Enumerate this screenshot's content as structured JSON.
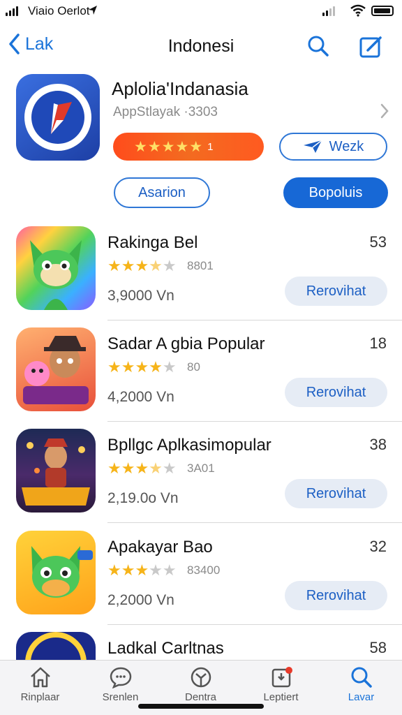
{
  "status_bar": {
    "carrier": "Viaio Oerlot"
  },
  "nav": {
    "back_label": "Lak",
    "title": "Indonesi"
  },
  "featured": {
    "title": "Aplolia'Indanasia",
    "subtitle": "AppStlayak  ·3303",
    "rating_count": "1",
    "secondary_label": "Wezk",
    "outline_button_label": "Asarion",
    "primary_button_label": "Bopoluis"
  },
  "apps": [
    {
      "name": "Rakinga Bel",
      "rank": "53",
      "stars": 3.5,
      "rating_count": "8801",
      "price": "3,9000 Vn",
      "button": "Rerovihat"
    },
    {
      "name": "Sadar A gbia Popular",
      "rank": "18",
      "stars": 4,
      "rating_count": "80",
      "price": "4,2000 Vn",
      "button": "Rerovihat"
    },
    {
      "name": "Bpllgc Aplkasimopular",
      "rank": "38",
      "stars": 3.5,
      "rating_count": "3A01",
      "price": "2,19.0o Vn",
      "button": "Rerovihat"
    },
    {
      "name": "Apakayar Bao",
      "rank": "32",
      "stars": 3,
      "rating_count": "83400",
      "price": "2,2000 Vn",
      "button": "Rerovihat"
    },
    {
      "name": "Ladkal Carltnas",
      "rank": "58"
    }
  ],
  "tabs": [
    {
      "label": "Rinplaar",
      "icon": "home-icon"
    },
    {
      "label": "Srenlen",
      "icon": "chat-icon"
    },
    {
      "label": "Dentra",
      "icon": "compass-icon"
    },
    {
      "label": "Leptiert",
      "icon": "updates-icon"
    },
    {
      "label": "Lavar",
      "icon": "search-icon"
    }
  ],
  "colors": {
    "accent": "#1a73d9",
    "rating_pill": "#f36b20",
    "star": "#f6b41a"
  }
}
